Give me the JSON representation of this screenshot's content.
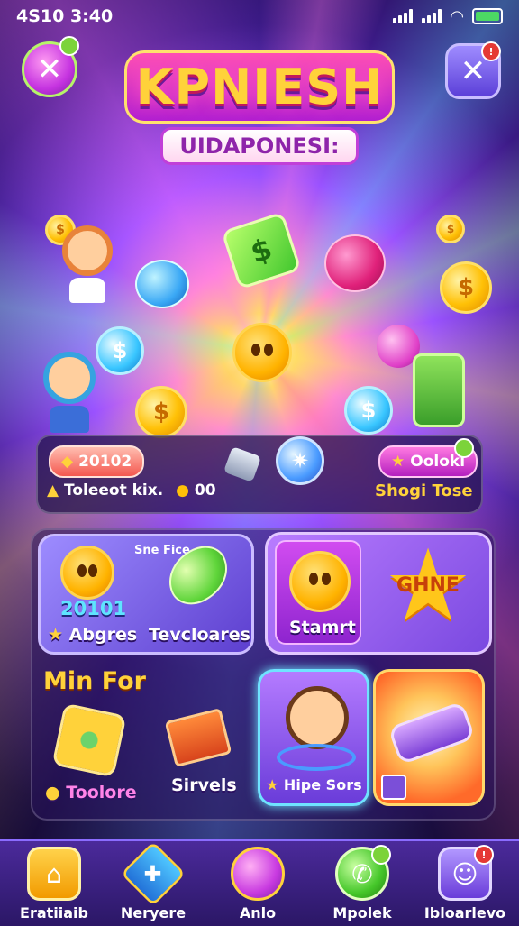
{
  "status_bar": {
    "time": "4S10  3:40"
  },
  "header": {
    "title": "KPNIESH",
    "subtitle": "UIDAPONESI:"
  },
  "info_bar": {
    "score_pill": "20102",
    "label_left": "Toleeot kix.",
    "label_left_value": "00",
    "button_right": "Ooloki",
    "label_right": "Shogi Tose"
  },
  "cards": {
    "card1_top": "Sne Fice",
    "card1_number": "20101",
    "card1_left_label": "Abgres",
    "card1_right_label": "Tevcloares",
    "start_label": "Stamrt",
    "game_label": "GHNE",
    "min_for": "Min For",
    "feature_left_label": "Toolore",
    "feature_mid_label": "Sirvels",
    "feature_hero_label": "Hipe Sors"
  },
  "bottom_nav": [
    {
      "label": "Eratiiaib",
      "icon": "home-icon"
    },
    {
      "label": "Neryere",
      "icon": "badge-icon"
    },
    {
      "label": "Anlo",
      "icon": "planet-icon"
    },
    {
      "label": "Mpolek",
      "icon": "chat-icon"
    },
    {
      "label": "Ibloarlevo",
      "icon": "profile-icon"
    }
  ],
  "colors": {
    "accent_pink": "#ff4fb4",
    "accent_gold": "#ffd23a",
    "accent_purple": "#8e24aa",
    "nav_bg": "#4b2a9b"
  }
}
